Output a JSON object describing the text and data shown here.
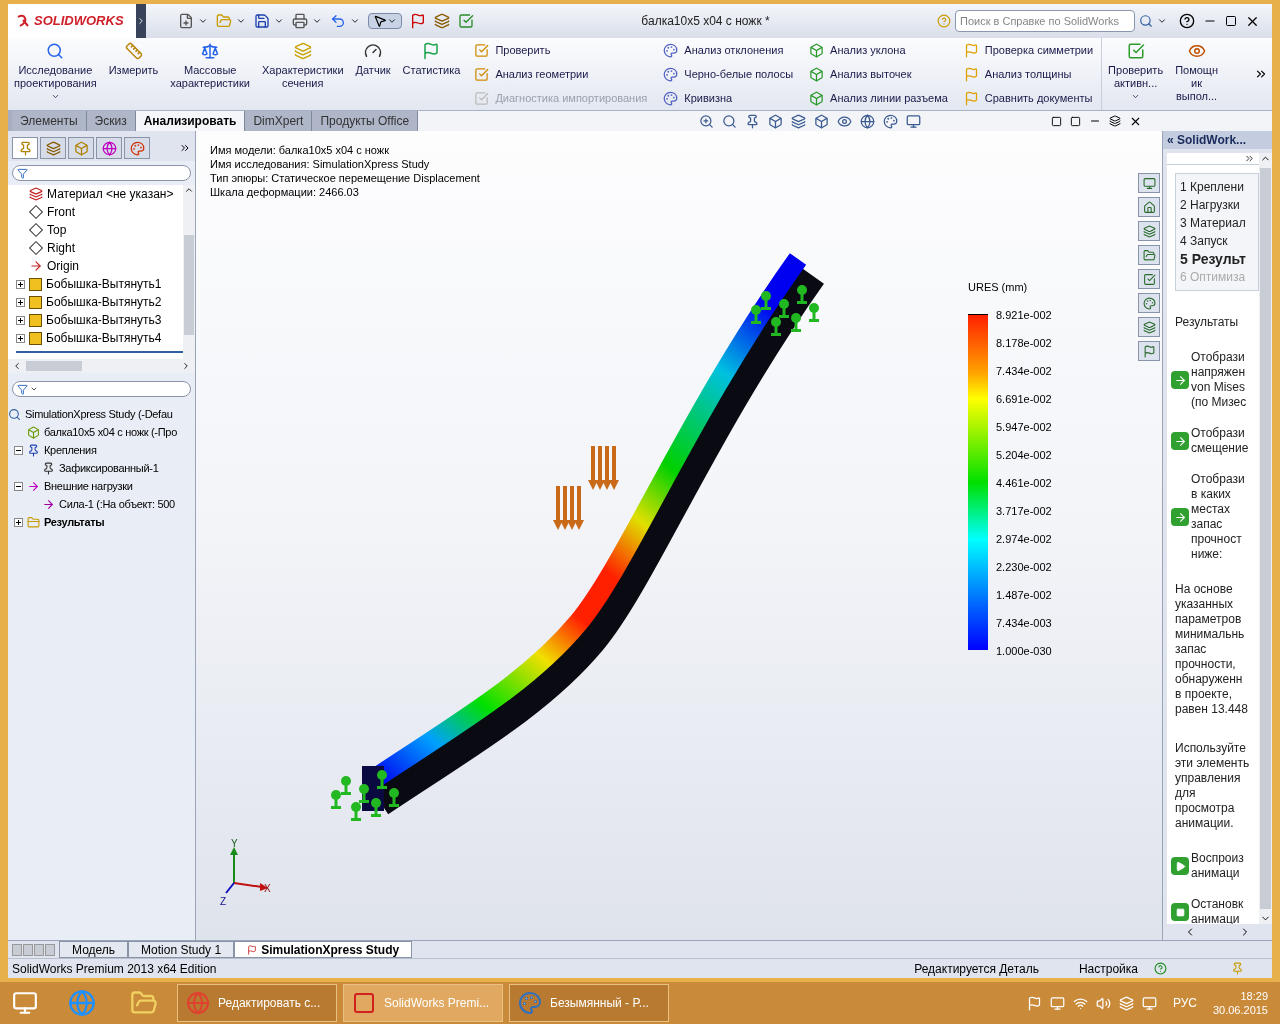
{
  "title_bar": {
    "logo": "SOLIDWORKS",
    "document_title": "балка10x5 x04 с ножк *",
    "search": {
      "placeholder": "Поиск в Справке по SolidWorks"
    }
  },
  "ribbon": {
    "large_buttons": [
      {
        "label": "Исследование\nпроектирования",
        "dropdown": true
      },
      {
        "label": "Измерить",
        "dropdown": false
      },
      {
        "label": "Массовые\nхарактеристики",
        "dropdown": false
      },
      {
        "label": "Характеристики\nсечения",
        "dropdown": false
      },
      {
        "label": "Датчик",
        "dropdown": false
      },
      {
        "label": "Статистика",
        "dropdown": false
      }
    ],
    "small_columns": [
      [
        {
          "label": "Проверить",
          "disabled": false
        },
        {
          "label": "Анализ геометрии",
          "disabled": false
        },
        {
          "label": "Диагностика импортирования",
          "disabled": true
        }
      ],
      [
        {
          "label": "Анализ отклонения",
          "disabled": false
        },
        {
          "label": "Черно-белые полосы",
          "disabled": false
        },
        {
          "label": "Кривизна",
          "disabled": false
        }
      ],
      [
        {
          "label": "Анализ уклона",
          "disabled": false
        },
        {
          "label": "Анализ выточек",
          "disabled": false
        },
        {
          "label": "Анализ линии разъема",
          "disabled": false
        }
      ],
      [
        {
          "label": "Проверка симметрии",
          "disabled": false
        },
        {
          "label": "Анализ толщины",
          "disabled": false
        },
        {
          "label": "Сравнить документы",
          "disabled": false
        }
      ]
    ],
    "end_buttons": [
      {
        "label": "Проверить\nактивн...",
        "dropdown": true
      },
      {
        "label": "Помощн\nик\nвыпол...",
        "dropdown": false
      }
    ]
  },
  "command_tabs": [
    {
      "label": "Элементы",
      "selected": false
    },
    {
      "label": "Эскиз",
      "selected": false
    },
    {
      "label": "Анализировать",
      "selected": true
    },
    {
      "label": "DimXpert",
      "selected": false
    },
    {
      "label": "Продукты Office",
      "selected": false
    }
  ],
  "manager_tabs": [
    {
      "selected": true
    },
    {
      "selected": false
    },
    {
      "selected": false
    },
    {
      "selected": false
    },
    {
      "selected": false
    }
  ],
  "feature_tree": {
    "items": [
      {
        "label": "Материал <не указан>",
        "kind": "material",
        "expandable": false
      },
      {
        "label": "Front",
        "kind": "plane",
        "expandable": false
      },
      {
        "label": "Top",
        "kind": "plane",
        "expandable": false
      },
      {
        "label": "Right",
        "kind": "plane",
        "expandable": false
      },
      {
        "label": "Origin",
        "kind": "origin",
        "expandable": false
      },
      {
        "label": "Бобышка-Вытянуть1",
        "kind": "feature",
        "expandable": true
      },
      {
        "label": "Бобышка-Вытянуть2",
        "kind": "feature",
        "expandable": true
      },
      {
        "label": "Бобышка-Вытянуть3",
        "kind": "feature",
        "expandable": true
      },
      {
        "label": "Бобышка-Вытянуть4",
        "kind": "feature",
        "expandable": true
      }
    ]
  },
  "study_tree": {
    "label": "SimulationXpress Study (-Defau",
    "children": [
      {
        "label": "балка10x5 x04 с ножк (-Про",
        "kind": "part",
        "bold": false,
        "expandable": false
      },
      {
        "label": "Крепления",
        "kind": "fixtures",
        "bold": false,
        "expandable": true,
        "expanded": true,
        "children": [
          {
            "label": "Зафиксированный-1",
            "kind": "fixed"
          }
        ]
      },
      {
        "label": "Внешние нагрузки",
        "kind": "loads",
        "bold": false,
        "expandable": true,
        "expanded": true,
        "children": [
          {
            "label": "Сила-1 (:На объект: 500",
            "kind": "force"
          }
        ]
      },
      {
        "label": "Результаты",
        "kind": "results",
        "bold": true,
        "expandable": true,
        "expanded": false
      }
    ]
  },
  "model_info": [
    "Имя модели: балка10x5 x04 с ножк",
    "Имя исследования: SimulationXpress Study",
    "Тип эпюры: Статическое перемещение Displacement",
    "Шкала деформации: 2466.03"
  ],
  "legend": {
    "title": "URES (mm)",
    "ticks": [
      "8.921e-002",
      "8.178e-002",
      "7.434e-002",
      "6.691e-002",
      "5.947e-002",
      "5.204e-002",
      "4.461e-002",
      "3.717e-002",
      "2.974e-002",
      "2.230e-002",
      "1.487e-002",
      "7.434e-003",
      "1.000e-030"
    ]
  },
  "triad": {
    "y": "Y",
    "x": "X",
    "z": "Z"
  },
  "task_pane": {
    "title": "« SolidWork...",
    "steps": [
      {
        "number": "1",
        "label": "Креплени",
        "selected": false,
        "disabled": false
      },
      {
        "number": "2",
        "label": "Нагрузки",
        "selected": false,
        "disabled": false
      },
      {
        "number": "3",
        "label": "Материал",
        "selected": false,
        "disabled": false
      },
      {
        "number": "4",
        "label": "Запуск",
        "selected": false,
        "disabled": false
      },
      {
        "number": "5",
        "label": "Результ",
        "selected": true,
        "disabled": false
      },
      {
        "number": "6",
        "label": "Оптимиза",
        "selected": false,
        "disabled": true
      }
    ],
    "heading": "Результаты",
    "blocks": [
      {
        "kind": "action",
        "text": "Отобрази\nнапряжен\nvon Mises\n(по Мизес"
      },
      {
        "kind": "action",
        "text": "Отобрази\nсмещение"
      },
      {
        "kind": "action",
        "text": "Отобрази\nв каких\nместах\nзапас\nпрочност\nниже:"
      },
      {
        "kind": "paragraph",
        "text": "На основе\nуказанных\nпараметров\nминимальнь\nзапас\nпрочности,\nобнаруженн\nв проекте,\nравен 13.448"
      },
      {
        "kind": "paragraph",
        "text": "Используйте\nэти элементь\nуправления\nдля\nпросмотра\nанимации."
      },
      {
        "kind": "play",
        "text": "Воспроиз\nанимаци"
      },
      {
        "kind": "stop",
        "text": "Остановк\nанимаци"
      }
    ]
  },
  "bottom_tabs": [
    {
      "label": "Модель",
      "selected": false
    },
    {
      "label": "Motion Study 1",
      "selected": false
    },
    {
      "label": "SimulationXpress Study",
      "selected": true
    }
  ],
  "status_bar": {
    "edition": "SolidWorks Premium 2013 x64 Edition",
    "mode": "Редактируется Деталь",
    "settings": "Настройка"
  },
  "taskbar": {
    "apps": [
      {
        "label": "Редактировать с...",
        "kind": "chrome",
        "selected": false
      },
      {
        "label": "SolidWorks Premi...",
        "kind": "solidworks",
        "selected": true
      },
      {
        "label": "Безымянный - P...",
        "kind": "paint",
        "selected": false
      }
    ],
    "language": "РУС",
    "time": "18:29",
    "date": "30.06.2015"
  }
}
